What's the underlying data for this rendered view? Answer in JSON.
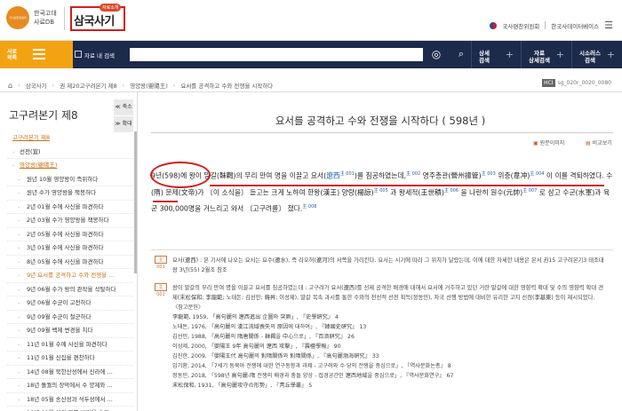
{
  "header": {
    "logo_seal": "국사편찬위원회",
    "logo_line1": "한국고대",
    "logo_line2": "사료DB",
    "brand_title": "삼국사기",
    "brand_badge": "자료소개",
    "org_name": "국사편찬위원회",
    "db_link": "한국사데이터베이스"
  },
  "navbar": {
    "history_label_1": "사료",
    "history_label_2": "목록",
    "inside_search_label": "자료 내 검색",
    "search_placeholder": "",
    "buttons": [
      {
        "l1": "상세",
        "l2": "검색"
      },
      {
        "l1": "자료",
        "l2": "상세검색"
      },
      {
        "l1": "시소러스",
        "l2": "검색"
      }
    ]
  },
  "breadcrumb": {
    "items": [
      "삼국사기",
      "권 제20고구려본기 제8",
      "영양왕(嬰陽王)",
      "요서를 공격하고 수와 전쟁을 시작하다"
    ],
    "hci_label": "HCI",
    "code": "sg_020r_0020_0080"
  },
  "sidebar": {
    "title": "고구려본기 제8",
    "collapse_label": "≪ 축소",
    "expand_label": "≫ 확대",
    "tree": [
      {
        "label": "고구려본기 제8",
        "level": 0
      },
      {
        "label": "선전(宣)",
        "level": 1
      },
      {
        "label": "영양왕(嬰陽王)",
        "level": 1,
        "active": true
      },
      {
        "label": "원년 10월 영양왕이 즉위하다",
        "level": 2
      },
      {
        "label": "원년 수가 영양왕을 책봉하다",
        "level": 2
      },
      {
        "label": "2년 01월 수에 사신을 파견하다",
        "level": 2
      },
      {
        "label": "2년 03월 수가 영양왕을 책봉하다",
        "level": 2
      },
      {
        "label": "2년 05월 수에 사신을 파견하다",
        "level": 2
      },
      {
        "label": "3년 01월 수에 사신을 파견하다",
        "level": 2
      },
      {
        "label": "8년 05월 수에 사신을 파견하다",
        "level": 2
      },
      {
        "label": "9년 요서를 공격하고 수와 전쟁을 ...",
        "level": 2,
        "highlight": true
      },
      {
        "label": "9년 06월 수가 왕의 관작을 삭탈하다",
        "level": 2
      },
      {
        "label": "9년 06월 수군이 고전하다",
        "level": 2
      },
      {
        "label": "9년 09월 수군이 철군하다",
        "level": 2
      },
      {
        "label": "9년 09월 백제 변경을 치다",
        "level": 2
      },
      {
        "label": "11년 01월 수에 사신을 파견하다",
        "level": 2
      },
      {
        "label": "11년 01월 신집을 편찬하다",
        "level": 2
      },
      {
        "label": "14년 08월 북한산성에서 신라에 ...",
        "level": 2
      },
      {
        "label": "18년 돌궐의 장막에서 수 양제와 ...",
        "level": 2
      },
      {
        "label": "18년 05월 송산성과 석두성에서 ...",
        "level": 2
      },
      {
        "label": "19년 02월 신라 북쪽 변경을 습격...",
        "level": 2
      }
    ]
  },
  "main": {
    "title": "요서를 공격하고 수와 전쟁을 시작하다 ( 598년 )",
    "original_image_label": "원문이미지",
    "compare_label": "비교보기",
    "para": {
      "s1": "9년(598)에 왕이 말갈(靺鞨)의 무리 만여 명을 이끌고 요서(",
      "s1_link": "遼西",
      "s1_fn": "主 001",
      "s2": ")를 침공하였는데,",
      "s2_fn": "主 002",
      "s3": " 영주총관(營州摠管)",
      "s3_fn": "主 003",
      "s4": " 위충(韋冲)",
      "s4_fn": "主 004",
      "s5": " 이 이를 격퇴하였다. 수(隋) 문제(文帝)가 〔이 소식을〕 듣고는 크게 노하여 한왕(漢王) 양량(楊諒)",
      "s5_fn": "主 005",
      "s6": " 과 왕세적(王世積)",
      "s6_fn": "主 006",
      "s7": " 을 나란히 원수(元帥)",
      "s7_fn": "主 007",
      "s8": " 로 삼고 수군(水軍)과 육군 300,000명을 거느리고 와서 〔고구려를〕 쳤다.",
      "s8_fn": "主 008"
    },
    "note1": {
      "tag": "主 001",
      "text": "요서(遼西) : 본 기사에 나오는 요서는 요수(遼水), 즉 라오허(遼河)의 서쪽을 가리킨다. 요서는 시기에 따라 그 위치가 달랐는데, 이에 대한 자세한 내용은 본서 권15 고구려본기3 태조대왕 3년(55) 2월조 참조"
    },
    "note2": {
      "tag": "主 002",
      "text": "왕이 말갈의 무리 만여 명을 이끌고 요서를 침공하였는데 : 고구려가 요서(遼西)를 선제 공격한 배경에 대해서 요서에 거주하고 있던 거란·말갈에 대한 영향력 확대 및 수의 영향력 확대 견제(末松保和; 李龍範; 노태돈; 김선민; 韓昇; 이성제), 말갈 복속 과시를 통한 수와의 전선적 선전 획득(정동민), 자국 선행 방법에 대비한 유리한 고지 선점(李基東) 등이 제시되었다.",
      "refs_title": "〈참고문헌〉",
      "refs": [
        "李龍範, 1959, 「高句麗의 遼西進出 企圖와 突厥」, 『史學硏究』 4",
        "노태돈, 1976, 「高句麗의 漢江流域喪失의 原因에 대하여」, 『韓國史硏究』 13",
        "김선민, 1988, 「高句麗의 隋唐關係 - 靺鞨을 中心으로」, 『百濟硏究』 26",
        "이성제, 2000, 「嬰陽王 9年 高句麗의 遼西 攻擊」, 『震檀學報』 90",
        "김진한, 2009, 「嬰陽王代 高句麗의 對隋關係와 對隋關係」, 『高句麗渤海硏究』 33",
        "임기환, 2014, 「7세기 동북아 전쟁에 대한 연구동향과 과제 - 고구려와 수·당의 전쟁을 중심으로」, 『역사문화논총』 8",
        "정동민, 2018, 「598년 高句麗-隋 전쟁의 배경과 충돌 양상 - 접경공간인 遼西地域을 중심으로」, 『역사문화연구』 67",
        "末松保和, 1931, 「高句麗攻守の形勢」, 『靑丘學叢』 5"
      ]
    }
  }
}
